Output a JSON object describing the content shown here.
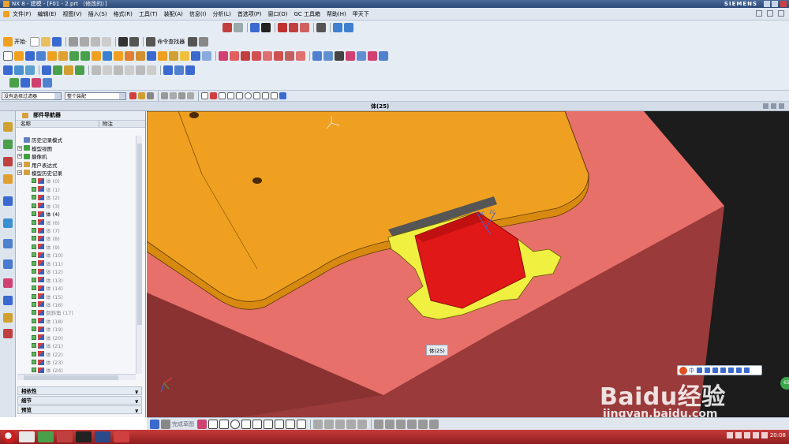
{
  "window": {
    "title": "NX 8 - 建模 - [F01 - 2.prt （修改的）]",
    "brand": "SIEMENS"
  },
  "menubar": {
    "items": [
      "文件(F)",
      "编辑(E)",
      "视图(V)",
      "插入(S)",
      "格式(R)",
      "工具(T)",
      "装配(A)",
      "信息(I)",
      "分析(L)",
      "首选项(P)",
      "窗口(O)",
      "GC 工具箱",
      "帮助(H)",
      "甲天下"
    ]
  },
  "toolbar": {
    "start_label": "开始·",
    "command_finder_label": "命令查找器"
  },
  "selection_bar": {
    "filter_value": "没有选择过滤器",
    "scope_value": "整个装配"
  },
  "view_title": "体(25)",
  "navigator": {
    "title": "部件导航器",
    "col_name": "名称",
    "col_note": "附注",
    "nodes": [
      {
        "label": "历史记录模式",
        "kind": "root",
        "exp": false,
        "icon_color": "#6080c0",
        "dim": false
      },
      {
        "label": "模型视图",
        "kind": "root",
        "exp": true,
        "icon_color": "#40a040",
        "dim": false
      },
      {
        "label": "摄像机",
        "kind": "root",
        "exp": true,
        "icon_color": "#40a040",
        "dim": false
      },
      {
        "label": "用户表达式",
        "kind": "root",
        "exp": true,
        "icon_color": "#d4a040",
        "dim": false
      },
      {
        "label": "模型历史记录",
        "kind": "root",
        "exp": true,
        "icon_color": "#d4a040",
        "dim": false
      },
      {
        "label": "体 (0)",
        "kind": "feat",
        "dim": true
      },
      {
        "label": "体 (1)",
        "kind": "feat",
        "dim": true
      },
      {
        "label": "体 (2)",
        "kind": "feat",
        "dim": true
      },
      {
        "label": "体 (3)",
        "kind": "feat",
        "dim": true
      },
      {
        "label": "体 (4)",
        "kind": "feat",
        "dim": false
      },
      {
        "label": "体 (6)",
        "kind": "feat",
        "dim": true
      },
      {
        "label": "体 (7)",
        "kind": "feat",
        "dim": true
      },
      {
        "label": "体 (8)",
        "kind": "feat",
        "dim": true
      },
      {
        "label": "体 (9)",
        "kind": "feat",
        "dim": true
      },
      {
        "label": "体 (10)",
        "kind": "feat",
        "dim": true
      },
      {
        "label": "体 (11)",
        "kind": "feat",
        "dim": true
      },
      {
        "label": "体 (12)",
        "kind": "feat",
        "dim": true
      },
      {
        "label": "体 (13)",
        "kind": "feat",
        "dim": true
      },
      {
        "label": "体 (14)",
        "kind": "feat",
        "dim": true
      },
      {
        "label": "体 (15)",
        "kind": "feat",
        "dim": true
      },
      {
        "label": "体 (16)",
        "kind": "feat",
        "dim": true
      },
      {
        "label": "倒斜角 (17)",
        "kind": "feat",
        "dim": true
      },
      {
        "label": "体 (18)",
        "kind": "feat",
        "dim": true
      },
      {
        "label": "体 (19)",
        "kind": "feat",
        "dim": true
      },
      {
        "label": "体 (20)",
        "kind": "feat",
        "dim": true
      },
      {
        "label": "体 (21)",
        "kind": "feat",
        "dim": true
      },
      {
        "label": "体 (22)",
        "kind": "feat",
        "dim": true
      },
      {
        "label": "体 (23)",
        "kind": "feat",
        "dim": true
      },
      {
        "label": "体 (24)",
        "kind": "feat",
        "dim": true
      }
    ],
    "sections": [
      "相依性",
      "细节",
      "预览"
    ]
  },
  "viewport": {
    "tooltip": "体(25)",
    "background": "#1c1c1c",
    "colors": {
      "block": "#e8706a",
      "block_side": "#8a3232",
      "part": "#f0a020",
      "slider": "#e01818",
      "insert": "#f0f040"
    }
  },
  "sketchbar": {
    "label": "完成草图"
  },
  "watermark": {
    "brand": "Baidu经验",
    "url": "jingyan.baidu.com",
    "ime_label": "中"
  },
  "taskbar": {
    "clock": "20:08",
    "badge": "65"
  }
}
